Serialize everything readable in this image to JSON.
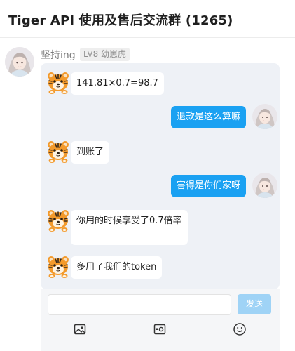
{
  "header": {
    "title": "Tiger API 使用及售后交流群 (1265)"
  },
  "sender": {
    "name": "坚持ing",
    "level": "LV8 幼崽虎"
  },
  "messages": [
    {
      "side": "left",
      "text": "141.81×0.7=98.7",
      "avatar": "tiger-icon"
    },
    {
      "side": "right",
      "text": "退款是这么算嘛",
      "avatar": "user-avatar"
    },
    {
      "side": "left",
      "text": "到账了",
      "avatar": "tiger-icon"
    },
    {
      "side": "right",
      "text": "害得是你们家呀",
      "avatar": "user-avatar"
    },
    {
      "side": "left",
      "text": "你用的时候享受了0.7倍率",
      "avatar": "tiger-icon"
    },
    {
      "side": "left",
      "text": "多用了我们的token",
      "avatar": "tiger-icon"
    }
  ],
  "composer": {
    "input_value": "",
    "send_label": "发送",
    "tools": [
      "image-icon",
      "media-icon",
      "emoji-icon"
    ]
  },
  "colors": {
    "accent": "#1aa1f2",
    "send_disabled": "#9fd3f6",
    "chat_background": "#eef1f6",
    "tiger_orange": "#f39a2c"
  }
}
